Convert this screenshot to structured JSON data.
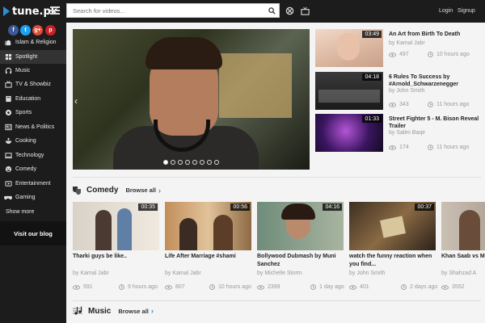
{
  "header": {
    "logo_text": "tune.pk",
    "search_placeholder": "Search for videos...",
    "login_label": "Login",
    "signup_label": "Signup",
    "icons": [
      "menu-icon",
      "search-icon",
      "settings-icon",
      "tv-icon"
    ]
  },
  "sidebar": {
    "social": [
      {
        "label": "f",
        "color": "#3b5998"
      },
      {
        "label": "t",
        "color": "#1da1f2"
      },
      {
        "label": "g+",
        "color": "#dd4b39"
      },
      {
        "label": "p",
        "color": "#cb2027"
      }
    ],
    "categories": [
      {
        "label": "Islam & Religion",
        "icon": "mosque-icon"
      },
      {
        "label": "Spotlight",
        "icon": "spotlight-icon"
      },
      {
        "label": "Music",
        "icon": "headphones-icon"
      },
      {
        "label": "TV & Showbiz",
        "icon": "tv-icon"
      },
      {
        "label": "Education",
        "icon": "book-icon"
      },
      {
        "label": "Sports",
        "icon": "ball-icon"
      },
      {
        "label": "News & Politics",
        "icon": "news-icon"
      },
      {
        "label": "Cooking",
        "icon": "cooking-icon"
      },
      {
        "label": "Technology",
        "icon": "tech-icon"
      },
      {
        "label": "Comedy",
        "icon": "comedy-icon"
      },
      {
        "label": "Entertainment",
        "icon": "entertainment-icon"
      },
      {
        "label": "Gaming",
        "icon": "gamepad-icon"
      }
    ],
    "active_index": 1,
    "show_more": "Show more",
    "blog": "Visit our blog"
  },
  "featured": {
    "slide_count": 8,
    "active_slide": 0,
    "side": [
      {
        "title": "An Art from Birth To Death",
        "by": "by Kamal Jabr",
        "duration": "03:49",
        "views": "497",
        "age": "10 hours ago"
      },
      {
        "title": "6 Rules To Success by #Arnold_Schwarzenegger",
        "by": "by John Smith",
        "duration": "04:18",
        "views": "343",
        "age": "11 hours ago"
      },
      {
        "title": "Street Fighter 5 - M. Bison Reveal Trailer",
        "by": "by Salim Baqir",
        "duration": "01:33",
        "views": "174",
        "age": "11 hours ago"
      }
    ]
  },
  "comedy": {
    "title": "Comedy",
    "browse": "Browse all",
    "videos": [
      {
        "title": "Tharki guys be like..",
        "by": "by Kamal Jabr",
        "duration": "00:35",
        "views": "591",
        "age": "9 hours ago"
      },
      {
        "title": "Life After Marriage #shami",
        "by": "by Kamal Jabr",
        "duration": "00:56",
        "views": "807",
        "age": "10 hours ago"
      },
      {
        "title": "Bollywood Dubmash by Muni Sanchez",
        "by": "by Michelle Storm",
        "duration": "04:16",
        "views": "2399",
        "age": "1 day ago"
      },
      {
        "title": "watch the funny reaction when you find...",
        "by": "by John Smith",
        "duration": "00:37",
        "views": "401",
        "age": "2 days ago"
      },
      {
        "title": "Khan Saab vs Must Watch",
        "by": "by Shahzad A",
        "duration": "",
        "views": "3552",
        "age": ""
      }
    ]
  },
  "music": {
    "title": "Music",
    "browse": "Browse all"
  }
}
